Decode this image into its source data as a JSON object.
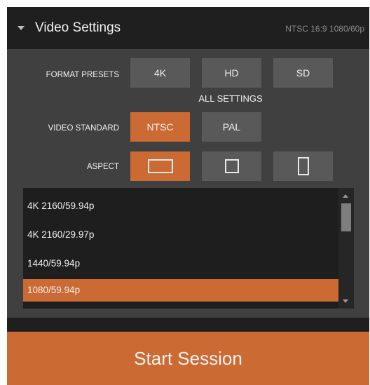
{
  "header": {
    "title": "Video Settings",
    "status": "NTSC 16:9 1080/60p"
  },
  "format_presets": {
    "label": "FORMAT PRESETS",
    "options": [
      "4K",
      "HD",
      "SD"
    ]
  },
  "all_settings_label": "ALL SETTINGS",
  "video_standard": {
    "label": "VIDEO STANDARD",
    "options": [
      "NTSC",
      "PAL"
    ],
    "selected": "NTSC"
  },
  "aspect": {
    "label": "ASPECT",
    "options": [
      "widescreen-icon",
      "square-icon",
      "portrait-icon"
    ],
    "selected": "widescreen-icon"
  },
  "resolution_list": {
    "items": [
      "4K 2160/59.94p",
      "4K 2160/29.97p",
      "1440/59.94p",
      "1080/59.94p"
    ],
    "selected": "1080/59.94p"
  },
  "start_button": "Start Session",
  "colors": {
    "accent": "#cb6a33",
    "panel": "#404040",
    "header": "#1f1f1f",
    "button": "#595959",
    "list_bg": "#1e1e1e"
  }
}
